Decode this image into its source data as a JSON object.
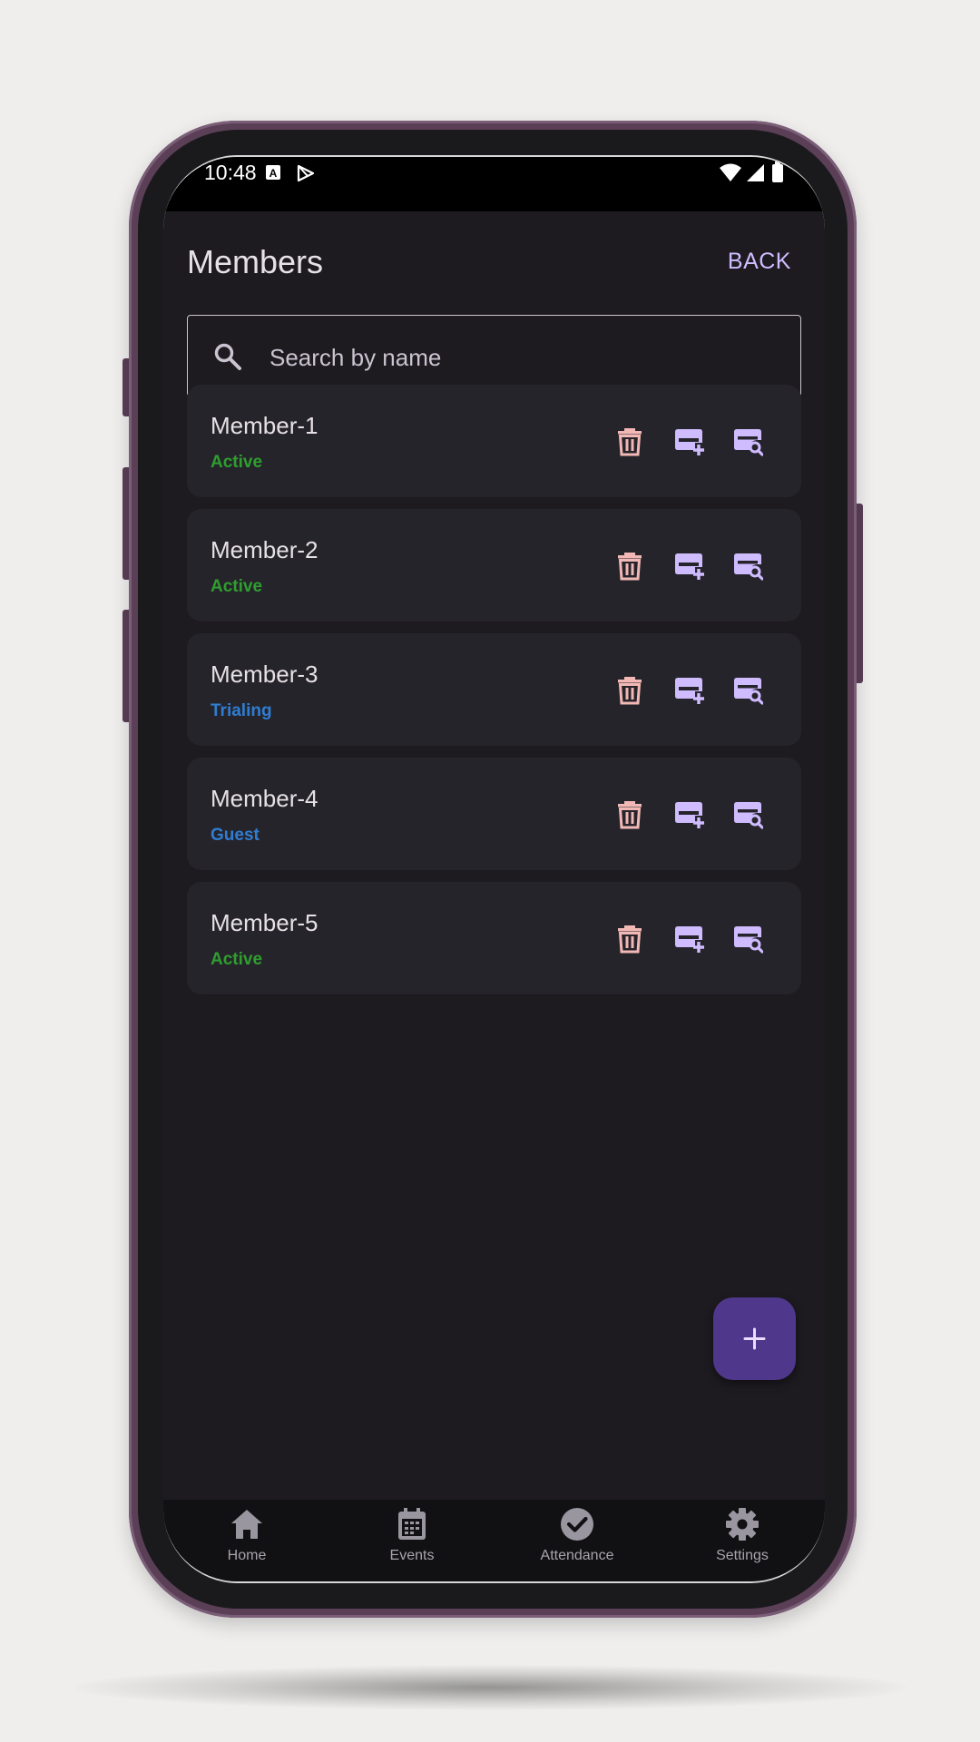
{
  "status_bar": {
    "time": "10:48"
  },
  "header": {
    "title": "Members",
    "back_label": "BACK"
  },
  "search": {
    "placeholder": "Search by name"
  },
  "members": [
    {
      "name": "Member-1",
      "status": "Active",
      "status_color": "#2e9e2e"
    },
    {
      "name": "Member-2",
      "status": "Active",
      "status_color": "#2e9e2e"
    },
    {
      "name": "Member-3",
      "status": "Trialing",
      "status_color": "#2f7dd1"
    },
    {
      "name": "Member-4",
      "status": "Guest",
      "status_color": "#2f7dd1"
    },
    {
      "name": "Member-5",
      "status": "Active",
      "status_color": "#2e9e2e"
    }
  ],
  "member_actions": [
    "trash-icon",
    "add-card-icon",
    "card-search-icon"
  ],
  "fab": {
    "icon": "plus-icon"
  },
  "bottom_nav": [
    {
      "label": "Home",
      "icon": "home-icon"
    },
    {
      "label": "Events",
      "icon": "calendar-icon"
    },
    {
      "label": "Attendance",
      "icon": "check-circle-icon"
    },
    {
      "label": "Settings",
      "icon": "gear-icon"
    }
  ],
  "colors": {
    "accent": "#cfbcff",
    "delete": "#f2b8b5",
    "fab": "#4f378b",
    "card": "#26242b",
    "background": "#1d1b20"
  }
}
